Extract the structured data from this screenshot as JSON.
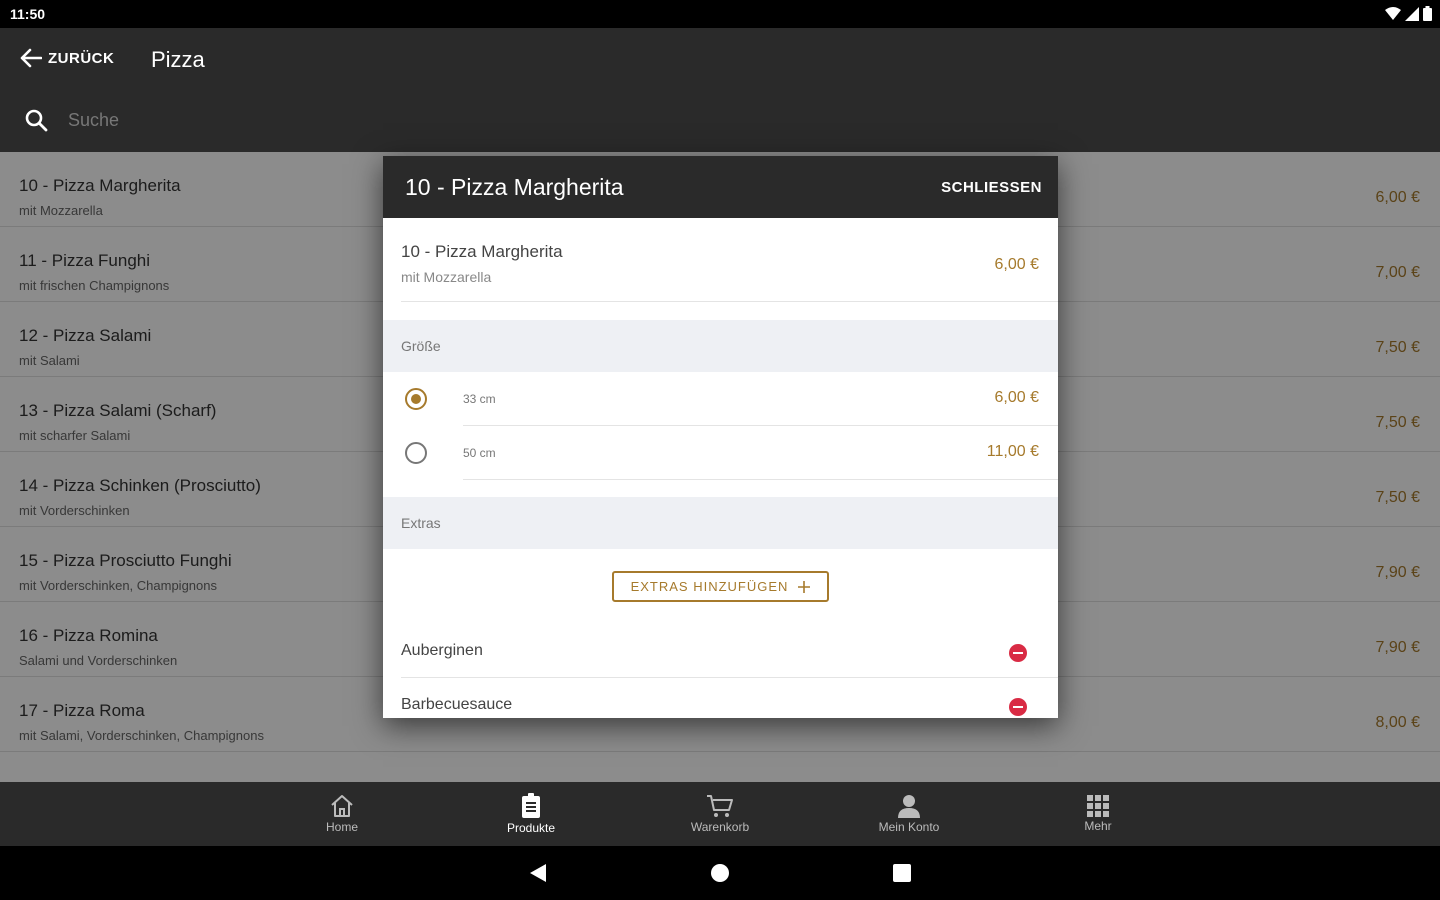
{
  "status_bar": {
    "time": "11:50"
  },
  "app_bar": {
    "back_label": "ZURÜCK",
    "title": "Pizza",
    "search_placeholder": "Suche"
  },
  "products": [
    {
      "name": "10 - Pizza Margherita",
      "description": "mit Mozzarella",
      "price": "6,00 €"
    },
    {
      "name": "11 - Pizza Funghi",
      "description": "mit frischen Champignons",
      "price": "7,00 €"
    },
    {
      "name": "12 - Pizza Salami",
      "description": "mit Salami",
      "price": "7,50 €"
    },
    {
      "name": "13 - Pizza Salami (Scharf)",
      "description": "mit scharfer Salami",
      "price": "7,50 €"
    },
    {
      "name": "14 - Pizza Schinken (Prosciutto)",
      "description": "mit Vorderschinken",
      "price": "7,50 €"
    },
    {
      "name": "15 - Pizza Prosciutto Funghi",
      "description": "mit Vorderschinken, Champignons",
      "price": "7,90 €"
    },
    {
      "name": "16 - Pizza Romina",
      "description": "Salami und Vorderschinken",
      "price": "7,90 €"
    },
    {
      "name": "17 - Pizza Roma",
      "description": "mit Salami, Vorderschinken, Champignons",
      "price": "8,00 €"
    }
  ],
  "dialog": {
    "title": "10 - Pizza Margherita",
    "close_label": "SCHLIESSEN",
    "product": {
      "name": "10 - Pizza Margherita",
      "description": "mit Mozzarella",
      "price": "6,00 €"
    },
    "size_section": "Größe",
    "sizes": [
      {
        "label": "33 cm",
        "price": "6,00 €",
        "selected": true
      },
      {
        "label": "50 cm",
        "price": "11,00 €",
        "selected": false
      }
    ],
    "extras_section": "Extras",
    "extras_button": "EXTRAS HINZUFÜGEN",
    "extras": [
      {
        "name": "Auberginen"
      },
      {
        "name": "Barbecuesauce"
      }
    ]
  },
  "bottom_nav": [
    {
      "label": "Home",
      "icon": "home-icon",
      "active": false
    },
    {
      "label": "Produkte",
      "icon": "menu-card-icon",
      "active": true
    },
    {
      "label": "Warenkorb",
      "icon": "cart-icon",
      "active": false
    },
    {
      "label": "Mein Konto",
      "icon": "person-icon",
      "active": false
    },
    {
      "label": "Mehr",
      "icon": "grid-icon",
      "active": false
    }
  ],
  "colors": {
    "accent": "#a67a2c",
    "bar": "#2a2a2a",
    "remove": "#d92b44"
  }
}
